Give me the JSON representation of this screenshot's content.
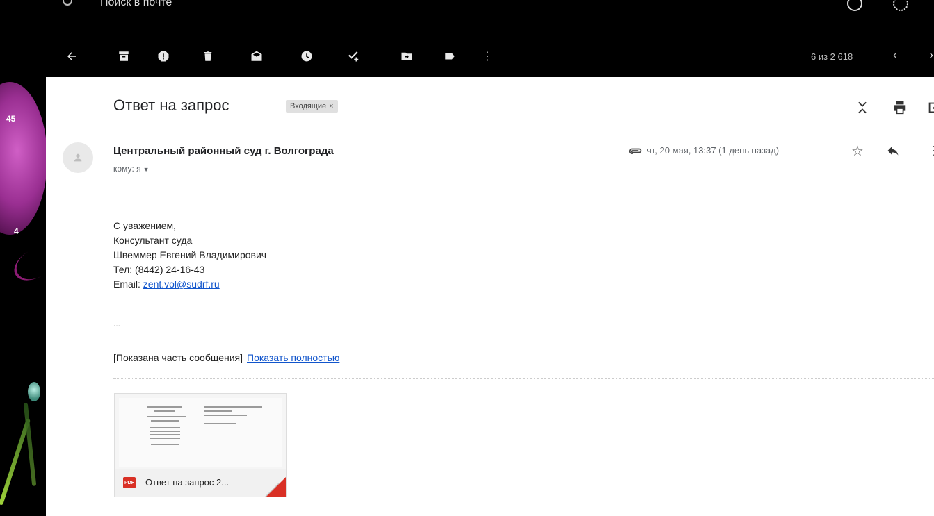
{
  "search": {
    "placeholder": "Поиск в почте"
  },
  "pager": {
    "text": "6 из 2 618"
  },
  "left_counts": [
    "45",
    "4"
  ],
  "email": {
    "subject": "Ответ на запрос",
    "label": "Входящие",
    "label_close": "×",
    "sender": "Центральный районный суд г. Волгограда",
    "to_prefix": "кому:",
    "to_value": "я",
    "date": "чт, 20 мая, 13:37 (1 день назад)",
    "body": {
      "line1": "С уважением,",
      "line2": "Консультант суда",
      "line3": "Швеммер Евгений Владимирович",
      "line4": "Тел: (8442) 24-16-43",
      "email_prefix": "Email:",
      "email_link": "zent.vol@sudrf.ru"
    },
    "ellipsis": "...",
    "trimmed_text": "[Показана часть сообщения]",
    "show_full": "Показать полностью",
    "attachment": {
      "type": "PDF",
      "name": "Ответ на запрос 2..."
    }
  }
}
